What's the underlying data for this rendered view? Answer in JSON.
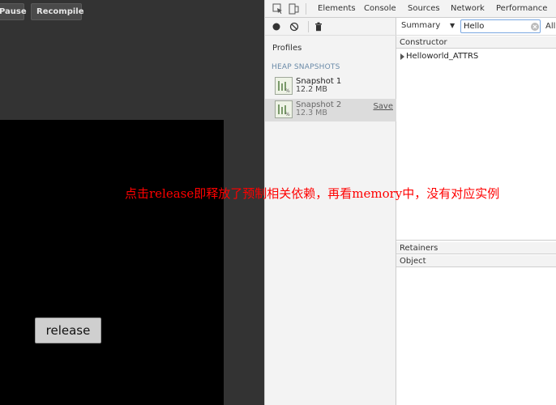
{
  "game": {
    "pause_label": "Pause",
    "recompile_label": "Recompile",
    "release_label": "release"
  },
  "devtools": {
    "tabs": [
      "Elements",
      "Console",
      "Sources",
      "Network",
      "Performance"
    ],
    "sidebar": {
      "profiles_label": "Profiles",
      "heap_header": "HEAP SNAPSHOTS",
      "snapshots": [
        {
          "name": "Snapshot 1",
          "size": "12.2 MB"
        },
        {
          "name": "Snapshot 2",
          "size": "12.3 MB",
          "action": "Save",
          "selected": true
        }
      ]
    },
    "main": {
      "view_select": "Summary",
      "filter_value": "Hello",
      "scope_label": "All",
      "constructor_header": "Constructor",
      "rows": [
        "Helloworld_ATTRS"
      ],
      "retainers_header": "Retainers",
      "object_header": "Object"
    }
  },
  "annotation": {
    "text": "点击release即释放了预制相关依赖，再看memory中，没有对应实例",
    "color": "#ff0000"
  }
}
